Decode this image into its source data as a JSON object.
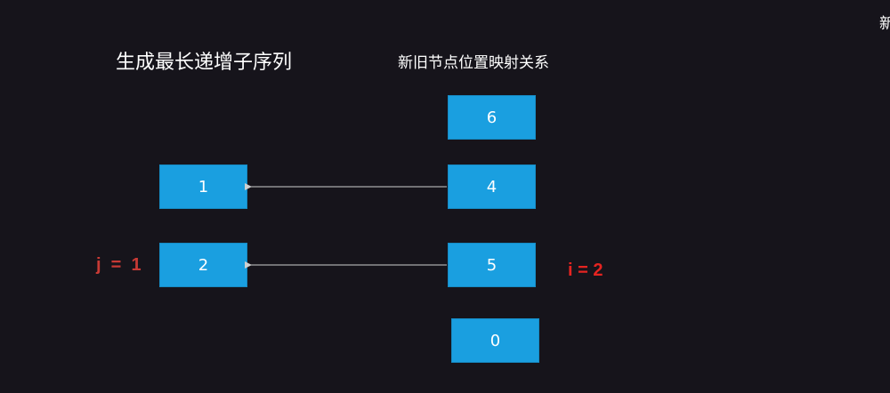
{
  "titles": {
    "left": "生成最长递增子序列",
    "right": "新旧节点位置映射关系",
    "corner": "新"
  },
  "sequence_boxes": [
    "1",
    "2"
  ],
  "mapping_boxes": [
    "6",
    "4",
    "5",
    "0"
  ],
  "pointers": {
    "j": "j  =  1",
    "i": "i = 2"
  },
  "colors": {
    "background": "#16141b",
    "box_fill": "#1a9fe0",
    "j_color": "#c83a35",
    "i_color": "#e52421",
    "arrow": "#cfcfcf"
  }
}
